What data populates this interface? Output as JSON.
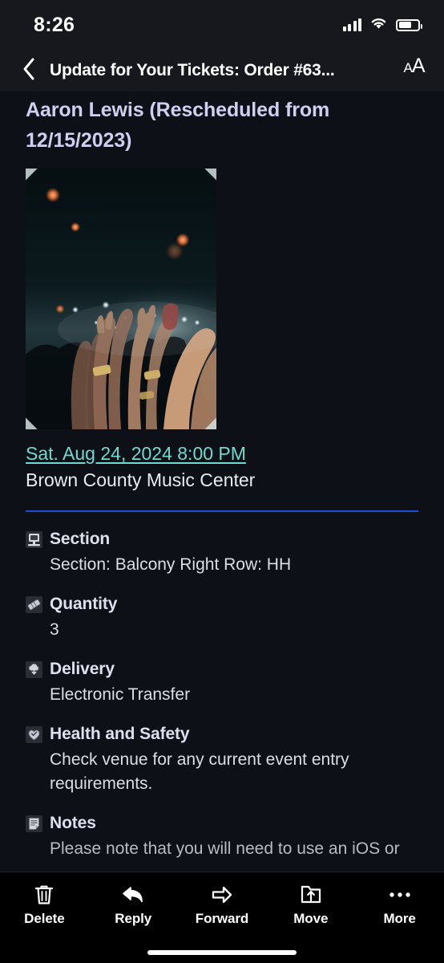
{
  "status_bar": {
    "time": "8:26",
    "signal_icon": "cellular-signal-icon",
    "wifi_icon": "wifi-icon",
    "battery_icon": "battery-icon",
    "battery_level_percent": 68
  },
  "nav_bar": {
    "back_icon": "chevron-left-icon",
    "title": "Update for Your Tickets: Order #63...",
    "text_size_small": "A",
    "text_size_large": "A",
    "text_size_icon": "text-size-icon"
  },
  "email": {
    "event_title": "Aaron Lewis (Rescheduled from 12/15/2023)",
    "photo_alt": "concert-crowd-photo",
    "event_date": "Sat. Aug 24, 2024 8:00 PM",
    "event_venue": "Brown County Music Center",
    "details": [
      {
        "icon": "seat-icon",
        "label": "Section",
        "value": "Section: Balcony Right Row: HH"
      },
      {
        "icon": "ticket-icon",
        "label": "Quantity",
        "value": "3"
      },
      {
        "icon": "delivery-cloud-icon",
        "label": "Delivery",
        "value": "Electronic Transfer"
      },
      {
        "icon": "heart-shield-icon",
        "label": "Health and Safety",
        "value": "Check venue for any current event entry requirements."
      },
      {
        "icon": "notes-icon",
        "label": "Notes",
        "value": "Please note that you will need to use an iOS or"
      }
    ]
  },
  "toolbar": {
    "items": [
      {
        "icon": "trash-icon",
        "label": "Delete"
      },
      {
        "icon": "reply-icon",
        "label": "Reply"
      },
      {
        "icon": "forward-icon",
        "label": "Forward"
      },
      {
        "icon": "move-folder-icon",
        "label": "Move"
      },
      {
        "icon": "more-ellipsis-icon",
        "label": "More"
      }
    ]
  },
  "colors": {
    "background": "#0d1117",
    "nav_background": "#16181d",
    "toolbar_background": "#000000",
    "title_text": "#cfd0f0",
    "link_text": "#6fd9cf",
    "divider": "#1d4ed8",
    "body_text": "#dcdde6"
  }
}
